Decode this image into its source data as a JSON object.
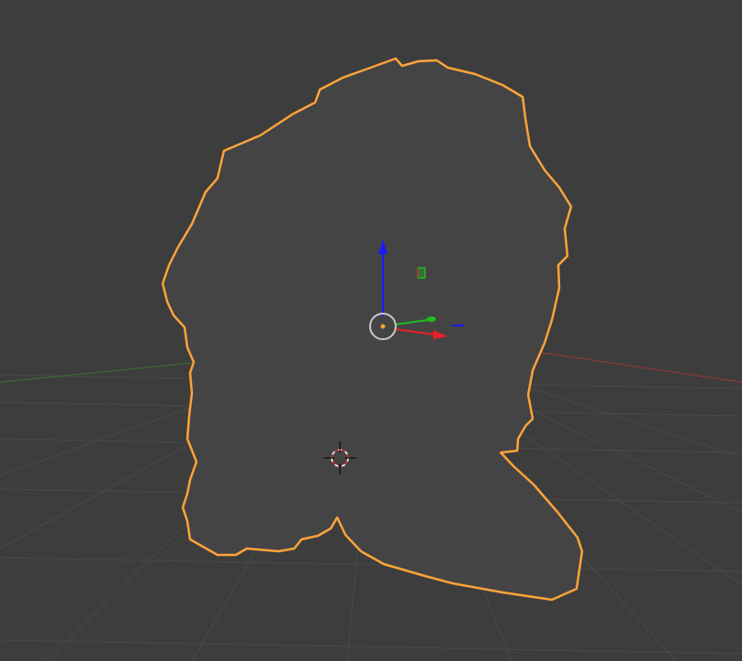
{
  "editor": {
    "type": "3D Viewport",
    "background_color": "#3d3d3d",
    "grid_color": "#4a4a4a",
    "x_axis_color": "#8a3a3a",
    "y_axis_color": "#3f6a35"
  },
  "selected_object": {
    "shape": "irregular flat mesh",
    "fill_color": "#444444",
    "outline_color": "#ffa33a",
    "state": "selected"
  },
  "gizmo": {
    "type": "transform-arrows",
    "z_color": "#1a1aff",
    "y_color": "#22bb22",
    "x_color": "#e8202a",
    "origin_ring_color": "#c8c8c8",
    "origin_dot_color": "#ffa33a"
  },
  "cursor_3d": {
    "type": "3d-cursor",
    "ring_colors": [
      "#ffffff",
      "#e8202a"
    ],
    "crosshair_color": "#111111"
  },
  "light_icon": {
    "type": "light",
    "color": "#22bb22",
    "border_color": "#cc2222"
  }
}
